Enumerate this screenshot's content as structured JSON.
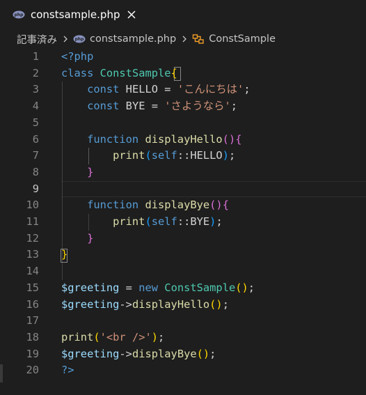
{
  "tab": {
    "title": "constsample.php",
    "icon": "php-file-icon",
    "close_icon": "close-icon"
  },
  "breadcrumb": {
    "folder": "記事済み",
    "file": "constsample.php",
    "class_name": "ConstSample",
    "file_icon": "php-file-icon",
    "class_icon": "class-symbol-icon"
  },
  "editor": {
    "active_line": 9,
    "line_numbers": [
      "1",
      "2",
      "3",
      "4",
      "5",
      "6",
      "7",
      "8",
      "9",
      "10",
      "11",
      "12",
      "13",
      "14",
      "15",
      "16",
      "17",
      "18",
      "19",
      "20"
    ],
    "lines": [
      [
        {
          "t": "<?php",
          "c": "k-tag"
        }
      ],
      [
        {
          "t": "class ",
          "c": "k-kw"
        },
        {
          "t": "ConstSample",
          "c": "k-cls"
        },
        {
          "t": "{",
          "c": "k-b1"
        }
      ],
      [
        {
          "t": "    const ",
          "c": "k-kw"
        },
        {
          "t": "HELLO = ",
          "c": "k-plain"
        },
        {
          "t": "'こんにちは'",
          "c": "k-str"
        },
        {
          "t": ";",
          "c": "k-plain"
        }
      ],
      [
        {
          "t": "    const ",
          "c": "k-kw"
        },
        {
          "t": "BYE = ",
          "c": "k-plain"
        },
        {
          "t": "'さようなら'",
          "c": "k-str"
        },
        {
          "t": ";",
          "c": "k-plain"
        }
      ],
      [],
      [
        {
          "t": "    function ",
          "c": "k-kw"
        },
        {
          "t": "displayHello",
          "c": "k-fn"
        },
        {
          "t": "()",
          "c": "k-b2"
        },
        {
          "t": "{",
          "c": "k-b2"
        }
      ],
      [
        {
          "t": "        print",
          "c": "k-fn"
        },
        {
          "t": "(",
          "c": "k-b3"
        },
        {
          "t": "self",
          "c": "k-kw"
        },
        {
          "t": "::HELLO",
          "c": "k-plain"
        },
        {
          "t": ")",
          "c": "k-b3"
        },
        {
          "t": ";",
          "c": "k-plain"
        }
      ],
      [
        {
          "t": "    }",
          "c": "k-b2"
        }
      ],
      [],
      [
        {
          "t": "    function ",
          "c": "k-kw"
        },
        {
          "t": "displayBye",
          "c": "k-fn"
        },
        {
          "t": "()",
          "c": "k-b2"
        },
        {
          "t": "{",
          "c": "k-b2"
        }
      ],
      [
        {
          "t": "        print",
          "c": "k-fn"
        },
        {
          "t": "(",
          "c": "k-b3"
        },
        {
          "t": "self",
          "c": "k-kw"
        },
        {
          "t": "::BYE",
          "c": "k-plain"
        },
        {
          "t": ")",
          "c": "k-b3"
        },
        {
          "t": ";",
          "c": "k-plain"
        }
      ],
      [
        {
          "t": "    }",
          "c": "k-b2"
        }
      ],
      [
        {
          "t": "}",
          "c": "k-b1"
        }
      ],
      [],
      [
        {
          "t": "$greeting",
          "c": "k-var"
        },
        {
          "t": " = ",
          "c": "k-plain"
        },
        {
          "t": "new ",
          "c": "k-kw"
        },
        {
          "t": "ConstSample",
          "c": "k-cls"
        },
        {
          "t": "()",
          "c": "k-b1"
        },
        {
          "t": ";",
          "c": "k-plain"
        }
      ],
      [
        {
          "t": "$greeting",
          "c": "k-var"
        },
        {
          "t": "->",
          "c": "k-plain"
        },
        {
          "t": "displayHello",
          "c": "k-fn"
        },
        {
          "t": "()",
          "c": "k-b1"
        },
        {
          "t": ";",
          "c": "k-plain"
        }
      ],
      [],
      [
        {
          "t": "print",
          "c": "k-fn"
        },
        {
          "t": "(",
          "c": "k-b1"
        },
        {
          "t": "'<br />'",
          "c": "k-str"
        },
        {
          "t": ")",
          "c": "k-b1"
        },
        {
          "t": ";",
          "c": "k-plain"
        }
      ],
      [
        {
          "t": "$greeting",
          "c": "k-var"
        },
        {
          "t": "->",
          "c": "k-plain"
        },
        {
          "t": "displayBye",
          "c": "k-fn"
        },
        {
          "t": "()",
          "c": "k-b1"
        },
        {
          "t": ";",
          "c": "k-plain"
        }
      ],
      [
        {
          "t": "?>",
          "c": "k-tag"
        }
      ]
    ]
  },
  "colors": {
    "background": "#1e1e1e",
    "keyword": "#569cd6",
    "class_name": "#4ec9b0",
    "string": "#ce9178",
    "function": "#dcdcaa",
    "variable": "#9cdcfe",
    "bracket_level1": "#ffd700",
    "bracket_level2": "#da70d6",
    "bracket_level3": "#179fff"
  }
}
